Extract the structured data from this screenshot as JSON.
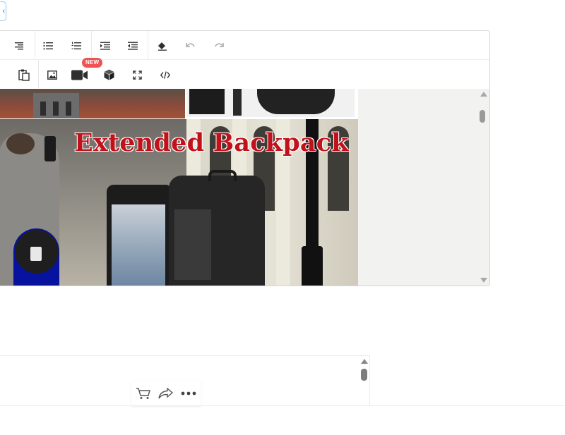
{
  "editor": {
    "toolbar_row1": [
      {
        "name": "align-right-icon",
        "disabled": false
      },
      {
        "name": "bulleted-list-icon",
        "disabled": false
      },
      {
        "name": "numbered-list-icon",
        "disabled": false
      },
      {
        "name": "indent-icon",
        "disabled": false
      },
      {
        "name": "outdent-icon",
        "disabled": false
      },
      {
        "name": "eraser-icon",
        "disabled": false
      },
      {
        "name": "undo-icon",
        "disabled": true
      },
      {
        "name": "redo-icon",
        "disabled": true
      }
    ],
    "toolbar_row2": [
      {
        "name": "paste-icon"
      },
      {
        "name": "image-icon"
      },
      {
        "name": "video-icon"
      },
      {
        "name": "3d-cube-icon"
      },
      {
        "name": "fullscreen-icon"
      },
      {
        "name": "code-icon"
      }
    ],
    "new_badge": "NEW",
    "banner_title": "Extended Backpack"
  },
  "colors": {
    "title_red": "#c1121b",
    "badge_red": "#f05252",
    "blue_badge": "#07139e",
    "content_bg": "#f2f2f1"
  },
  "actions": [
    {
      "name": "cart-icon"
    },
    {
      "name": "share-icon"
    },
    {
      "name": "more-icon"
    }
  ]
}
